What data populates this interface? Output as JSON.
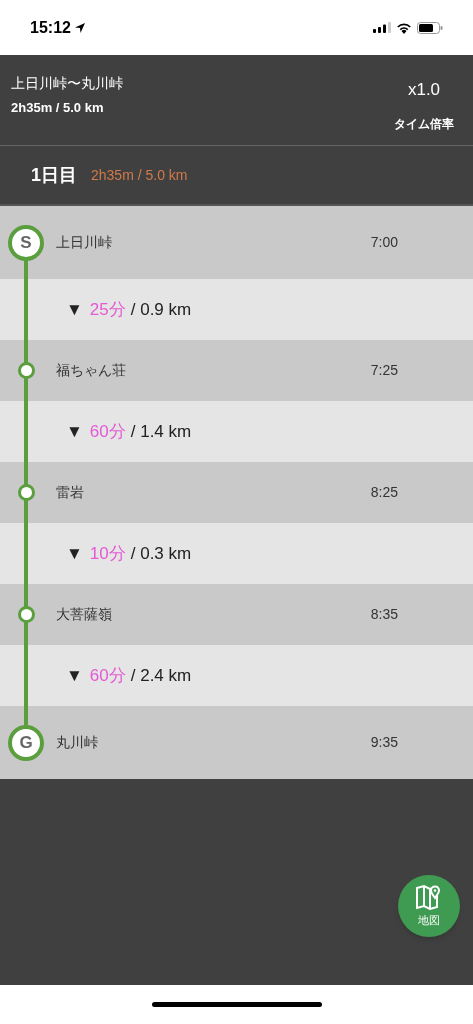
{
  "status_bar": {
    "time": "15:12"
  },
  "header": {
    "title": "上日川峠〜丸川峠",
    "summary": "2h35m / 5.0 km",
    "multiplier": "x1.0",
    "multiplier_label": "タイム倍率"
  },
  "day": {
    "label": "1日目",
    "summary": "2h35m / 5.0 km"
  },
  "route": [
    {
      "kind": "start",
      "badge": "S",
      "name": "上日川峠",
      "time": "7:00"
    },
    {
      "kind": "segment",
      "arrow": "▼",
      "duration": "25分",
      "distance": "/ 0.9 km"
    },
    {
      "kind": "waypoint",
      "name": "福ちゃん荘",
      "time": "7:25"
    },
    {
      "kind": "segment",
      "arrow": "▼",
      "duration": "60分",
      "distance": "/ 1.4 km"
    },
    {
      "kind": "waypoint",
      "name": "雷岩",
      "time": "8:25"
    },
    {
      "kind": "segment",
      "arrow": "▼",
      "duration": "10分",
      "distance": "/ 0.3 km"
    },
    {
      "kind": "waypoint",
      "name": "大菩薩嶺",
      "time": "8:35"
    },
    {
      "kind": "segment",
      "arrow": "▼",
      "duration": "60分",
      "distance": "/ 2.4 km"
    },
    {
      "kind": "goal",
      "badge": "G",
      "name": "丸川峠",
      "time": "9:35"
    }
  ],
  "map_button": {
    "label": "地図"
  }
}
